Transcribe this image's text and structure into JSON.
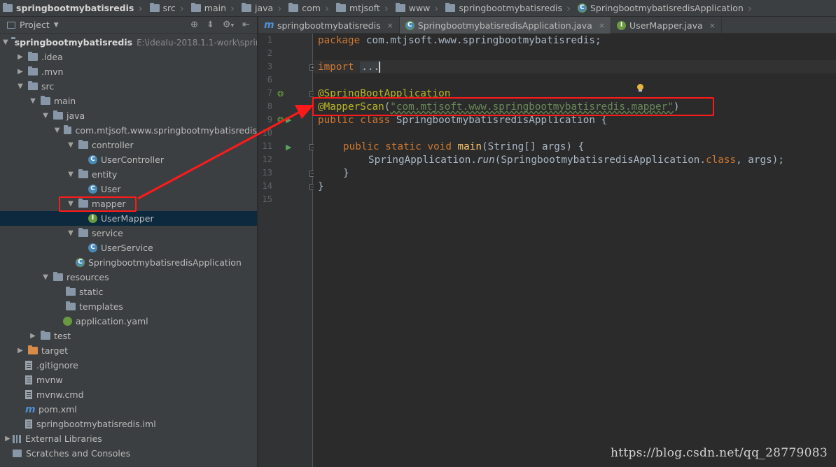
{
  "breadcrumb": [
    "springbootmybatisredis",
    "src",
    "main",
    "java",
    "com",
    "mtjsoft",
    "www",
    "springbootmybatisredis",
    "SpringbootmybatisredisApplication"
  ],
  "project_panel": {
    "title": "Project",
    "tree": [
      {
        "label": "springbootmybatisredis",
        "path": "E:\\ideaIu-2018.1.1-work\\sprin",
        "icon": "folder-icon",
        "depth": 0,
        "expanded": true,
        "bold": true
      },
      {
        "label": ".idea",
        "icon": "folder-icon",
        "depth": 1,
        "expanded": false
      },
      {
        "label": ".mvn",
        "icon": "folder-icon",
        "depth": 1,
        "expanded": false
      },
      {
        "label": "src",
        "icon": "folder-icon",
        "depth": 1,
        "expanded": true
      },
      {
        "label": "main",
        "icon": "folder-icon",
        "depth": 2,
        "expanded": true
      },
      {
        "label": "java",
        "icon": "folder-icon",
        "depth": 3,
        "expanded": true
      },
      {
        "label": "com.mtjsoft.www.springbootmybatisredis",
        "icon": "package-icon",
        "depth": 4,
        "expanded": true
      },
      {
        "label": "controller",
        "icon": "package-icon",
        "depth": 5,
        "expanded": true
      },
      {
        "label": "UserController",
        "icon": "class-icon",
        "depth": 6
      },
      {
        "label": "entity",
        "icon": "package-icon",
        "depth": 5,
        "expanded": true
      },
      {
        "label": "User",
        "icon": "class-icon",
        "depth": 6
      },
      {
        "label": "mapper",
        "icon": "package-icon",
        "depth": 5,
        "expanded": true
      },
      {
        "label": "UserMapper",
        "icon": "interface-icon",
        "depth": 6,
        "selected": true
      },
      {
        "label": "service",
        "icon": "package-icon",
        "depth": 5,
        "expanded": true
      },
      {
        "label": "UserService",
        "icon": "class-icon",
        "depth": 6
      },
      {
        "label": "SpringbootmybatisredisApplication",
        "icon": "spring-class-icon",
        "depth": 5
      },
      {
        "label": "resources",
        "icon": "folder-icon",
        "depth": 3,
        "expanded": true
      },
      {
        "label": "static",
        "icon": "folder-icon",
        "depth": 4
      },
      {
        "label": "templates",
        "icon": "folder-icon",
        "depth": 4
      },
      {
        "label": "application.yaml",
        "icon": "yaml-icon",
        "depth": 4
      },
      {
        "label": "test",
        "icon": "folder-icon",
        "depth": 2,
        "expanded": false
      },
      {
        "label": "target",
        "icon": "orange-folder-icon",
        "depth": 1,
        "expanded": false
      },
      {
        "label": ".gitignore",
        "icon": "file-icon",
        "depth": 1
      },
      {
        "label": "mvnw",
        "icon": "file-icon",
        "depth": 1
      },
      {
        "label": "mvnw.cmd",
        "icon": "file-icon",
        "depth": 1
      },
      {
        "label": "pom.xml",
        "icon": "maven-icon",
        "depth": 1
      },
      {
        "label": "springbootmybatisredis.iml",
        "icon": "file-icon",
        "depth": 1
      },
      {
        "label": "External Libraries",
        "icon": "library-icon",
        "depth": 0,
        "expanded": false
      },
      {
        "label": "Scratches and Consoles",
        "icon": "scratch-icon",
        "depth": 0
      }
    ]
  },
  "editor_tabs": [
    {
      "label": "springbootmybatisredis",
      "icon": "maven-icon",
      "active": false
    },
    {
      "label": "SpringbootmybatisredisApplication.java",
      "icon": "spring-class-icon",
      "active": true
    },
    {
      "label": "UserMapper.java",
      "icon": "interface-icon",
      "active": false
    }
  ],
  "code": {
    "line_numbers": [
      "1",
      "2",
      "3",
      "6",
      "7",
      "8",
      "9",
      "10",
      "11",
      "12",
      "13",
      "14",
      "15"
    ],
    "package_kw": "package",
    "package_name": " com.mtjsoft.www.springbootmybatisredis;",
    "import_kw": "import",
    "import_folded": "...",
    "annotation_app": "@SpringBootApplication",
    "annotation_scan": "@MapperScan",
    "scan_open": "(",
    "scan_value": "\"com.mtjsoft.www.springbootmybatisredis.mapper\"",
    "scan_close": ")",
    "class_kw": "public class",
    "class_name": " SpringbootmybatisredisApplication {",
    "main_kw": "public static void",
    "main_name": "main",
    "main_args": "(String[] args) {",
    "run_prefix": "SpringApplication.",
    "run_method": "run",
    "run_args_start": "(SpringbootmybatisredisApplication.",
    "run_class_kw": "class",
    "run_args_end": ", args);",
    "close_inner": "}",
    "close_outer": "}"
  },
  "watermark": "https://blog.csdn.net/qq_28779083",
  "colors": {
    "annotation_box": "#ff1a1a",
    "keyword": "#cc7832",
    "annotation": "#bbb529",
    "string": "#6a8759"
  }
}
